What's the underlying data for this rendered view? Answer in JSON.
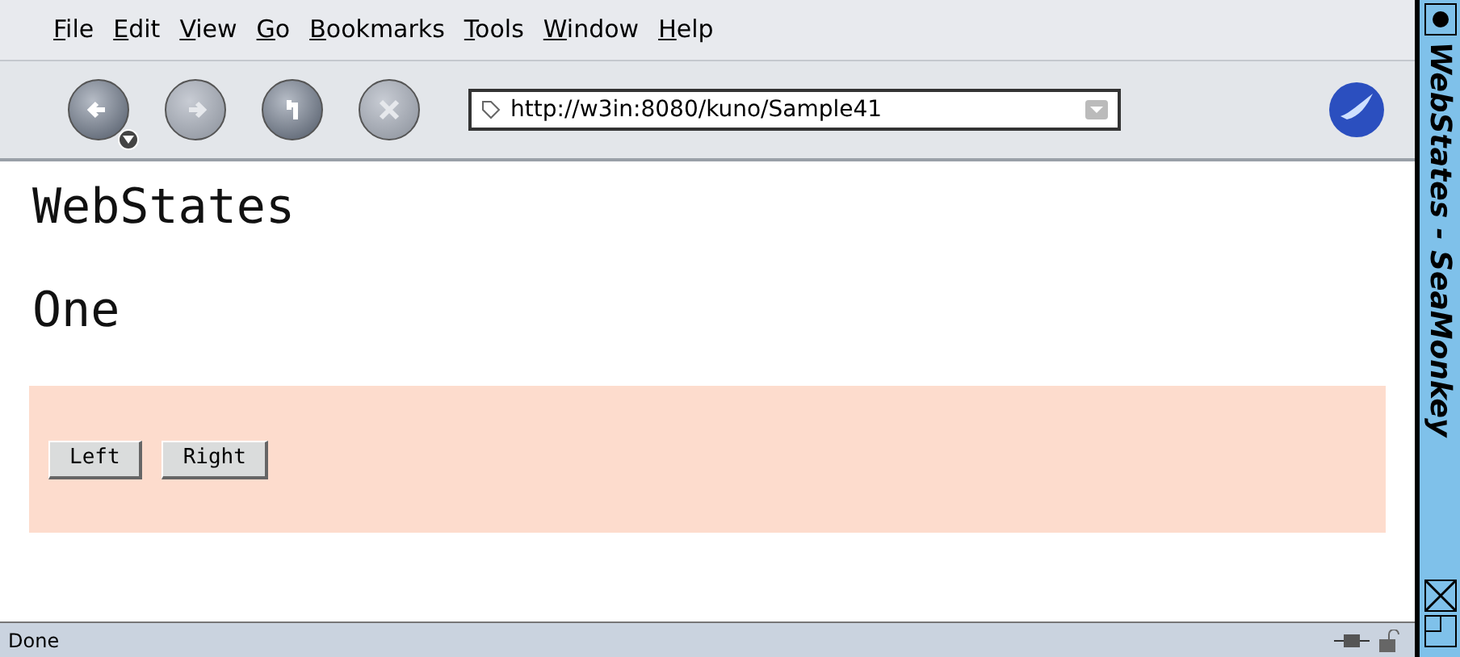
{
  "menu": [
    "File",
    "Edit",
    "View",
    "Go",
    "Bookmarks",
    "Tools",
    "Window",
    "Help"
  ],
  "address": {
    "value": "http://w3in:8080/kuno/Sample41"
  },
  "page": {
    "title": "WebStates",
    "subtitle": "One",
    "buttons": [
      "Left",
      "Right"
    ]
  },
  "status_bar": {
    "text": "Done"
  },
  "window": {
    "title": "WebStates - SeaMonkey"
  }
}
